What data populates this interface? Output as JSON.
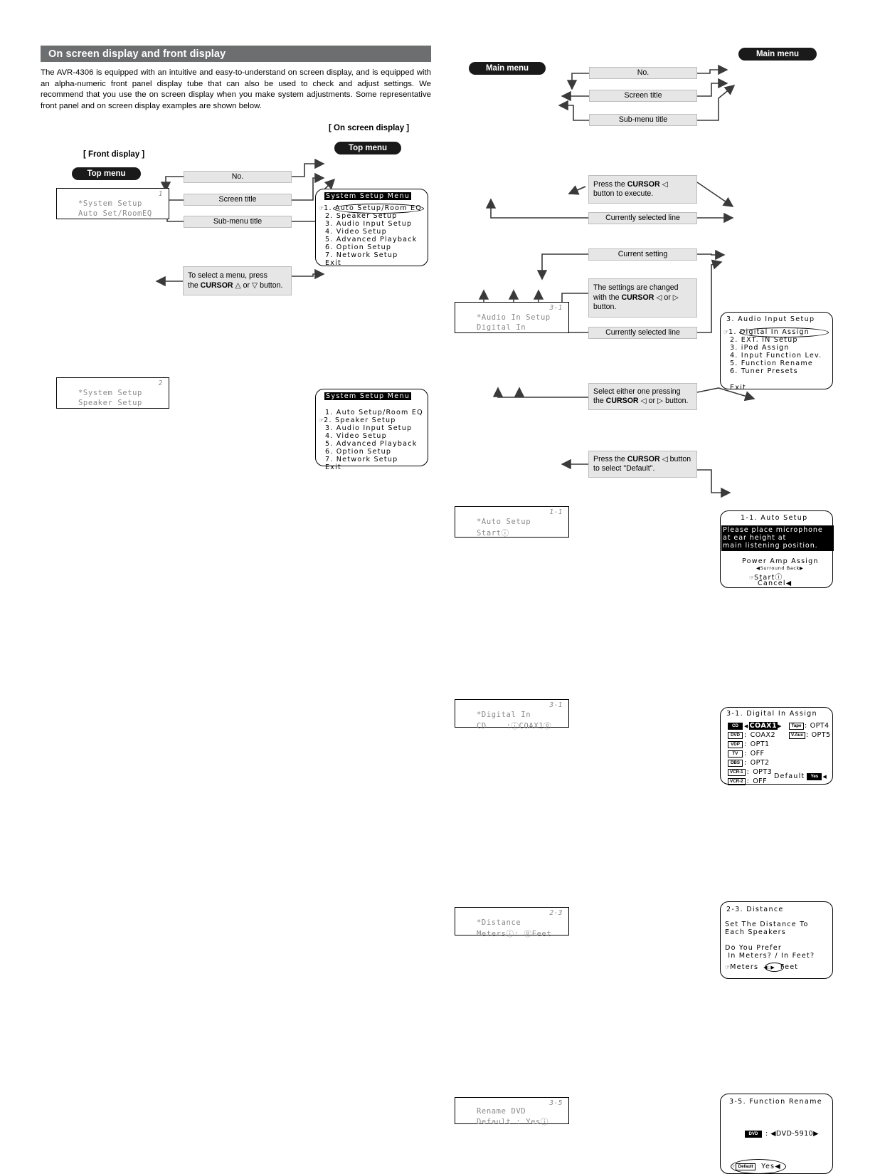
{
  "section": {
    "header": "On screen display and front display",
    "paragraph": "The AVR-4306 is equipped with an intuitive and easy-to-understand on screen display, and is equipped with an alpha-numeric front panel display tube that can also be used to check and adjust settings. We recommend that you use the on screen display when you make system adjustments. Some representative front panel and on screen display examples are shown below."
  },
  "labels": {
    "front_display": "[ Front display ]",
    "on_screen_display": "[ On screen display ]",
    "top_menu": "Top menu",
    "main_menu": "Main menu",
    "no": "No.",
    "screen_title": "Screen title",
    "sub_menu_title": "Sub-menu title",
    "currently_selected_line": "Currently selected line",
    "current_setting": "Current setting"
  },
  "callouts": {
    "select_menu": {
      "line1": "To select a menu, press",
      "line2_pre": "the ",
      "line2_bold": "CURSOR",
      "line2_post": " △ or ▽ button."
    },
    "press_execute": {
      "line1_pre": "Press    the    ",
      "line1_bold": "CURSOR",
      "line1_post": "  ◁",
      "line2": "button to execute."
    },
    "settings_changed": {
      "line1": "The settings are changed",
      "line2_pre": "with  the  ",
      "line2_bold": "CURSOR",
      "line2_post": " ◁ or ▷",
      "line3": "button."
    },
    "select_either": {
      "line1": "Select either one pressing",
      "line2_pre": "the ",
      "line2_bold": "CURSOR",
      "line2_post": " ◁ or ▷ button."
    },
    "press_default": {
      "line1_pre": "Press the ",
      "line1_bold": "CURSOR",
      "line1_post": " ◁ button",
      "line2": "to select \"Default\"."
    }
  },
  "front_displays": {
    "system_setup_1": {
      "no": "1",
      "line1": "*System Setup",
      "line2": "Auto Set/RoomEQ"
    },
    "system_setup_2": {
      "no": "2",
      "line1": "*System Setup",
      "line2": "Speaker Setup"
    },
    "audio_in_setup": {
      "no": "3-1",
      "line1": "*Audio In Setup",
      "line2": "Digital In"
    },
    "auto_setup": {
      "no": "1-1",
      "line1": "*Auto Setup",
      "line2": "Startⓘ"
    },
    "digital_in": {
      "no": "3-1",
      "line1": "*Digital In",
      "line2": "CD    :ⓘCOAX1ⓟ"
    },
    "distance": {
      "no": "2-3",
      "line1": "*Distance",
      "line2": "Metersⓘ: ⓟFeet"
    },
    "rename_dvd": {
      "no": "3-5",
      "line1": "Rename DVD",
      "line2": "Default : Yesⓘ"
    }
  },
  "osd": {
    "system_setup_menu_1": {
      "title": "System Setup Menu",
      "items": [
        {
          "cursor": true,
          "text": "1. Auto Setup/Room EQ",
          "highlight_oval": true
        },
        {
          "cursor": false,
          "text": "2. Speaker Setup"
        },
        {
          "cursor": false,
          "text": "3. Audio Input Setup"
        },
        {
          "cursor": false,
          "text": "4. Video Setup"
        },
        {
          "cursor": false,
          "text": "5. Advanced Playback"
        },
        {
          "cursor": false,
          "text": "6. Option Setup"
        },
        {
          "cursor": false,
          "text": "7. Network Setup"
        },
        {
          "cursor": false,
          "text": "Exit"
        }
      ]
    },
    "system_setup_menu_2": {
      "title": "System Setup Menu",
      "items": [
        {
          "cursor": false,
          "text": "1. Auto Setup/Room EQ"
        },
        {
          "cursor": true,
          "text": "2. Speaker Setup"
        },
        {
          "cursor": false,
          "text": "3. Audio Input Setup"
        },
        {
          "cursor": false,
          "text": "4. Video Setup"
        },
        {
          "cursor": false,
          "text": "5. Advanced Playback"
        },
        {
          "cursor": false,
          "text": "6. Option Setup"
        },
        {
          "cursor": false,
          "text": "7. Network Setup"
        },
        {
          "cursor": false,
          "text": "Exit"
        }
      ]
    },
    "audio_input_setup": {
      "title": "3. Audio Input Setup",
      "items": [
        {
          "cursor": true,
          "text": "1. Digital In Assign",
          "highlight_oval": true
        },
        {
          "cursor": false,
          "text": "2. EXT. IN Setup"
        },
        {
          "cursor": false,
          "text": "3. iPod Assign"
        },
        {
          "cursor": false,
          "text": "4. Input Function Lev."
        },
        {
          "cursor": false,
          "text": "5. Function Rename"
        },
        {
          "cursor": false,
          "text": "6. Tuner Presets"
        },
        {
          "cursor": false,
          "text": ""
        },
        {
          "cursor": false,
          "text": "Exit"
        }
      ]
    },
    "auto_setup": {
      "title": "1-1. Auto Setup",
      "message": [
        "Please place microphone",
        "at ear height at",
        "main listening position."
      ],
      "power_amp_label": "Power Amp Assign",
      "power_amp_value": "◀Surround Back▶",
      "start_line": "Startⓘ",
      "cancel_line": "Cancel◀"
    },
    "digital_in_assign": {
      "title": "3-1. Digital In Assign",
      "left_rows": [
        {
          "tag": "CD",
          "tag_inverted": true,
          "value": "COAX1",
          "value_inverted": true,
          "arrows": true
        },
        {
          "tag": "DVD",
          "tag_inverted": false,
          "value": "COAX2"
        },
        {
          "tag": "VDP",
          "tag_inverted": false,
          "value": "OPT1"
        },
        {
          "tag": "TV",
          "tag_inverted": false,
          "value": "OFF"
        },
        {
          "tag": "DBS",
          "tag_inverted": false,
          "value": "OPT2"
        },
        {
          "tag": "VCR-1",
          "tag_inverted": false,
          "value": "OPT3"
        },
        {
          "tag": "VCR-2",
          "tag_inverted": false,
          "value": "OFF"
        }
      ],
      "right_rows": [
        {
          "tag": "Tape",
          "value": "OPT4"
        },
        {
          "tag": "V.Aux",
          "value": "OPT5"
        }
      ],
      "default_label": "Default",
      "default_value": "Yes",
      "default_arrow": "◀"
    },
    "distance": {
      "title": "2-3. Distance",
      "lines": [
        "Set The Distance To",
        "Each Speakers",
        "",
        "Do You Prefer",
        " In Meters? / In Feet?"
      ],
      "choice_left": "Meters",
      "choice_mid": "◀:▶",
      "choice_right": "Feet"
    },
    "function_rename": {
      "title": "3-5. Function Rename",
      "tag": "DVD",
      "value": ": ◀DVD-5910▶",
      "default_label": "Default",
      "default_value": "Yes◀"
    }
  }
}
